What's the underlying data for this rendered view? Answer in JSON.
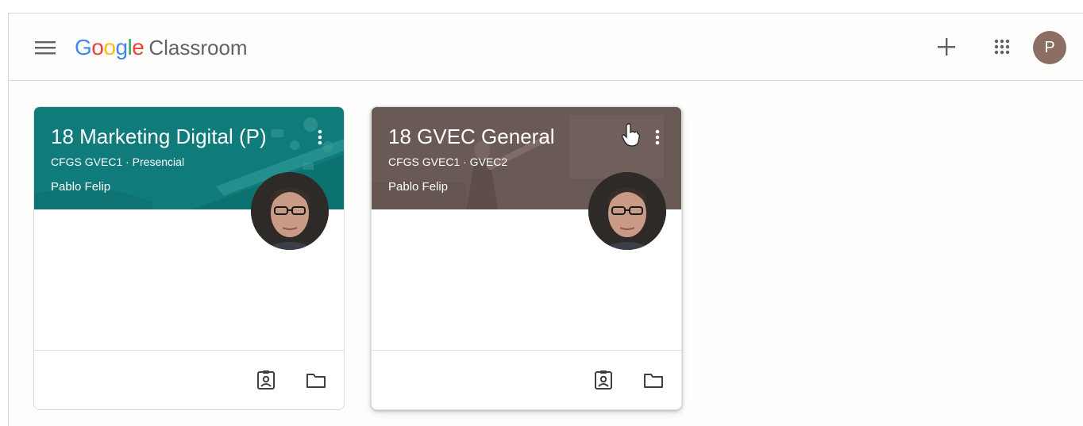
{
  "header": {
    "logo_google": [
      "G",
      "o",
      "o",
      "g",
      "l",
      "e"
    ],
    "logo_colors": [
      "#4285f4",
      "#ea4335",
      "#fbbc05",
      "#4285f4",
      "#34a853",
      "#ea4335"
    ],
    "product_name": "Classroom",
    "avatar_letter": "P",
    "icons": [
      "menu-icon",
      "plus-icon",
      "apps-grid-icon"
    ]
  },
  "classes": [
    {
      "title": "18 Marketing Digital (P)",
      "section": "CFGS GVEC1 · Presencial",
      "teacher": "Pablo Felip",
      "banner_color": "#0f7c7b",
      "footer_icons": [
        "assignment-ind-icon",
        "folder-icon"
      ]
    },
    {
      "title": "18 GVEC General",
      "section": "CFGS GVEC1 · GVEC2",
      "teacher": "Pablo Felip",
      "banner_color": "#6f5e59",
      "footer_icons": [
        "assignment-ind-icon",
        "folder-icon"
      ]
    }
  ]
}
